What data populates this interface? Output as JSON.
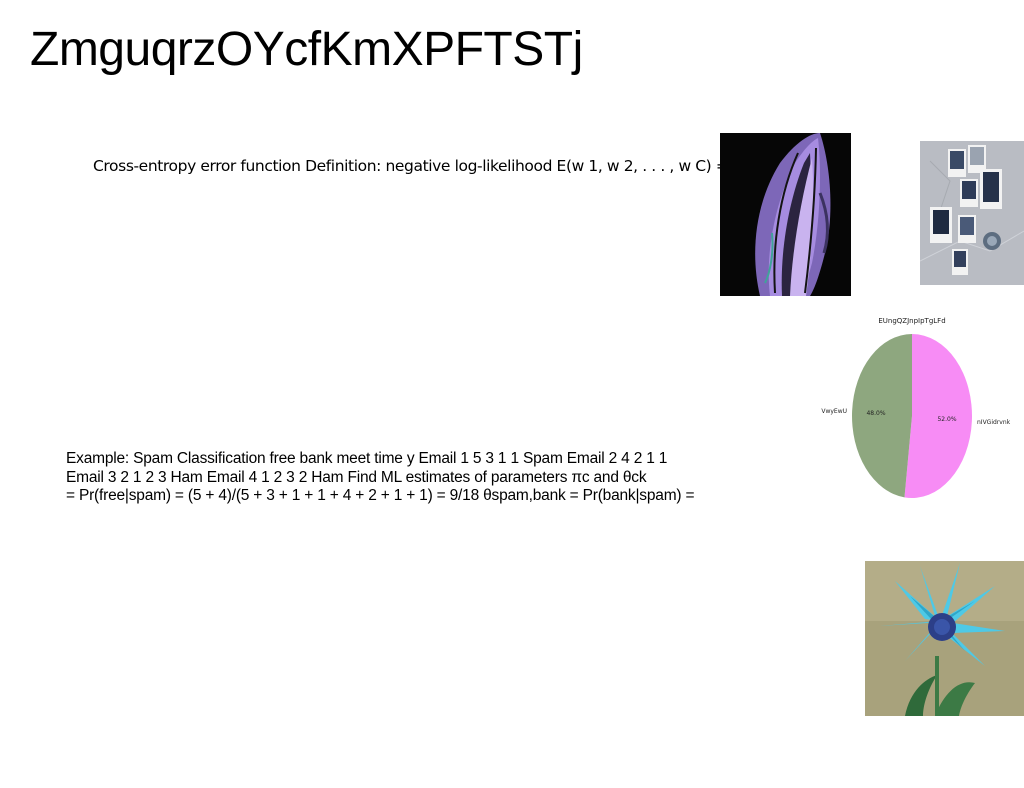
{
  "slide": {
    "title": "ZmguqrzOYcfKmXPFTSTj",
    "text1": "Cross-entropy error function Definition: negative log-likelihood E(w 1, w 2, . . . , w C) = −",
    "text2_lines": [
      "Example: Spam Classification free bank meet time y Email 1 5 3 1 1 Spam Email 2 4 2 1 1",
      "Email 3 2 1 2 3 Ham Email 4 1 2 3 2 Ham Find ML estimates of parameters πc and θck",
      "= Pr(free|spam) = (5 + 4)/(5 + 3 + 1 + 1 + 4 + 2 + 1 + 1) = 9/18 θspam,bank = Pr(bank|spam) ="
    ]
  },
  "images": {
    "feather": "abstract-purple-feather-image",
    "wall": "polaroid-photos-on-wall-image",
    "flower": "blue-flower-image"
  },
  "chart_data": {
    "type": "pie",
    "title": "EUngQZJnpIpTgLFd",
    "labels": [
      "nIVGidrvnk",
      "VwyEwU"
    ],
    "values": [
      52.0,
      48.0
    ],
    "value_labels": [
      "52.0%",
      "48.0%"
    ],
    "colors": [
      "#f78cf5",
      "#8ea77f"
    ]
  }
}
